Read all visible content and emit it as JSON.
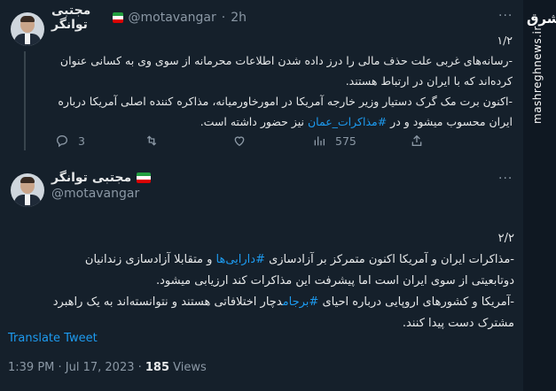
{
  "tweet1": {
    "author": "مجتبی توانگر",
    "handle": "@motavangar",
    "time": "2h",
    "counter": "۱/۲",
    "line1": "-رسانه‌های غربی علت حذف مالی را درز داده شدن اطلاعات محرمانه از سوی وی به کسانی عنوان",
    "line2": "کرده‌اند که با ایران در ارتباط هستند.",
    "line3": "-اکنون برت مک گرک دستیار وزیر خارجه آمریکا در امورخاورمیانه، مذاکره کننده اصلی آمریکا درباره",
    "line4_pre": "ایران محسوب میشود و در ",
    "line4_tag": "#مذاکرات_عمان",
    "line4_post": " نیز حضور داشته است.",
    "replies": "3",
    "views": "575"
  },
  "tweet2": {
    "author": "مجتبی توانگر",
    "handle": "@motavangar",
    "counter": "۲/۲",
    "p1_pre": "-مذاکرات ایران و آمریکا اکنون متمرکز بر آزادسازی ",
    "p1_tag": "#دارایی‌ها",
    "p1_post": " و متقابلا آزادسازی زندانیان",
    "p2": "دوتابعیتی از سوی ایران است اما پیشرفت این مذاکرات کند ارزیابی میشود.",
    "p3_pre": "-آمریکا و کشورهای اروپایی درباره احیای ",
    "p3_tag": "#برجام",
    "p3_post": "دچار اختلافاتی هستند و نتوانسته‌اند به یک راهبرد",
    "p4": "مشترک دست پیدا کنند.",
    "translate_label": "Translate Tweet",
    "timestamp": "1:39 PM · Jul 17, 2023 · ",
    "views_count": "185",
    "views_label": " Views"
  },
  "watermark": {
    "logo_text": "مشرق",
    "site": "mashreghnews.ir"
  },
  "colors": {
    "background": "#15202b",
    "accent": "#1d9bf0",
    "muted": "#8b98a5",
    "flag": [
      "#239f40",
      "#ffffff",
      "#da0000"
    ]
  }
}
